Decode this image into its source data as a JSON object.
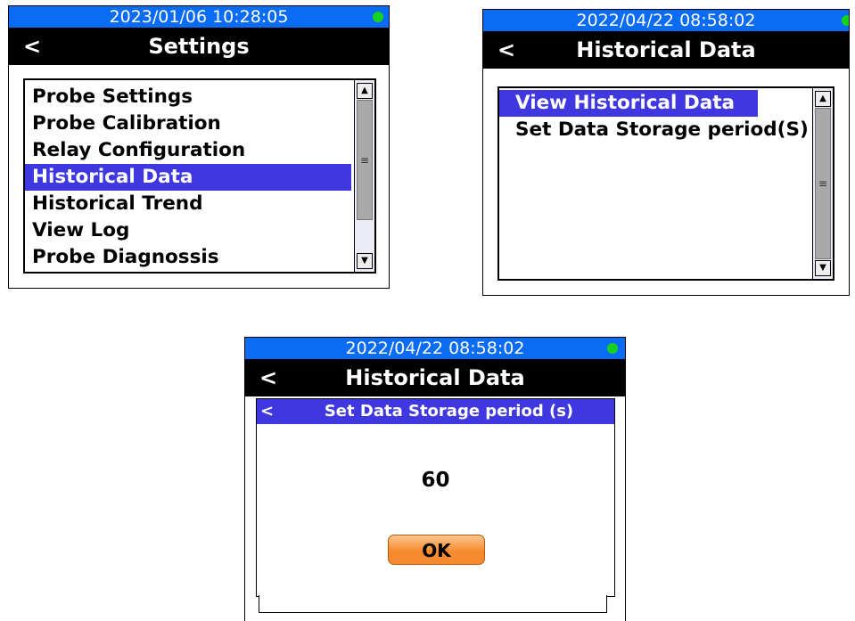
{
  "screen1": {
    "status": {
      "datetime": "2023/01/06  10:28:05",
      "indicator_color": "#16d21d"
    },
    "header": {
      "back": "<",
      "title": "Settings"
    },
    "menu": {
      "items": [
        "Probe Settings",
        "Probe Calibration",
        "Relay Configuration",
        "Historical Data",
        "Historical Trend",
        "View Log",
        "Probe Diagnossis"
      ],
      "selected_index": 3
    },
    "scrollbar": {
      "up": "▲",
      "down": "▼",
      "grip": "≡"
    }
  },
  "screen2": {
    "status": {
      "datetime": "2022/04/22  08:58:02",
      "indicator_color": "#16d21d"
    },
    "header": {
      "back": "<",
      "title": "Historical Data"
    },
    "menu": {
      "items": [
        "View Historical Data",
        "Set Data Storage period(S)"
      ],
      "selected_index": 0
    },
    "scrollbar": {
      "up": "▲",
      "down": "▼",
      "grip": "≡"
    }
  },
  "screen3": {
    "status": {
      "datetime": "2022/04/22  08:58:02",
      "indicator_color": "#16d21d"
    },
    "header": {
      "back": "<",
      "title": "Historical Data"
    },
    "dialog": {
      "back": "<",
      "title": "Set Data Storage period  (s)",
      "value": "60",
      "ok_label": "OK"
    }
  },
  "colors": {
    "status_bar": "#0a6cf5",
    "selection": "#3f38e0",
    "ok_button": "#f58a2f"
  }
}
